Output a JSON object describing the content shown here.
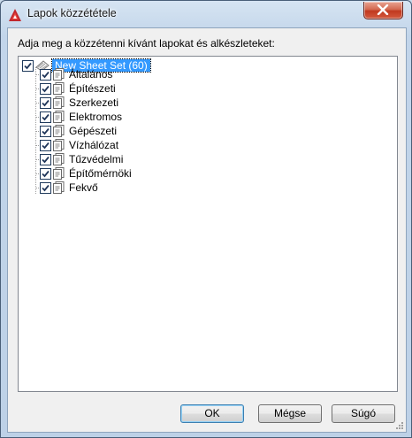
{
  "window": {
    "title": "Lapok közzététele",
    "accent_color": "#c1391f",
    "app_icon": "autocad-icon",
    "close_icon": "close-icon"
  },
  "prompt": "Adja meg a közzétenni kívánt lapokat és alkészleteket:",
  "tree": {
    "root": {
      "label": "New Sheet Set (60)",
      "checked": true,
      "selected": true
    },
    "subsets": [
      {
        "label": "Általános",
        "checked": true
      },
      {
        "label": "Építészeti",
        "checked": true
      },
      {
        "label": "Szerkezeti",
        "checked": true
      },
      {
        "label": "Elektromos",
        "checked": true
      },
      {
        "label": "Gépészeti",
        "checked": true
      },
      {
        "label": "Vízhálózat",
        "checked": true
      },
      {
        "label": "Tűzvédelmi",
        "checked": true
      },
      {
        "label": "Építőmérnöki",
        "checked": true
      },
      {
        "label": "Fekvő",
        "checked": true
      }
    ]
  },
  "buttons": {
    "ok": "OK",
    "cancel": "Mégse",
    "help": "Súgó"
  }
}
